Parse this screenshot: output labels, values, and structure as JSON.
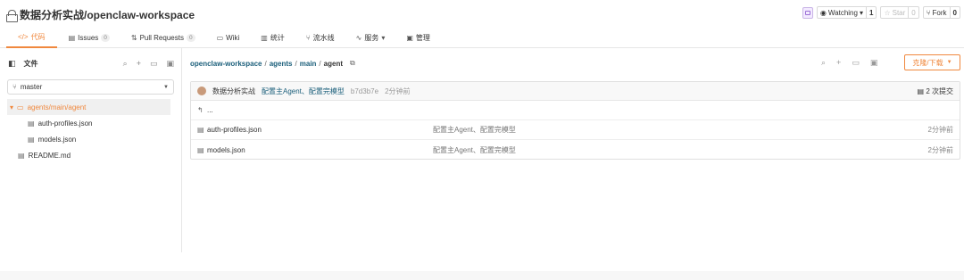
{
  "repo": {
    "title": "数据分析实战/openclaw-workspace"
  },
  "actions": {
    "watching_label": "Watching",
    "watching_count": "1",
    "star_label": "Star",
    "star_count": "0",
    "fork_label": "Fork",
    "fork_count": "0"
  },
  "tabs": [
    {
      "label": "代码",
      "icon": "code-icon"
    },
    {
      "label": "Issues",
      "badge": "0",
      "icon": "issues-icon"
    },
    {
      "label": "Pull Requests",
      "badge": "0",
      "icon": "pull-request-icon"
    },
    {
      "label": "Wiki",
      "icon": "wiki-icon"
    },
    {
      "label": "统计",
      "icon": "stats-icon"
    },
    {
      "label": "流水线",
      "icon": "pipeline-icon"
    },
    {
      "label": "服务",
      "icon": "service-icon"
    },
    {
      "label": "管理",
      "icon": "manage-icon"
    }
  ],
  "sidebar": {
    "title": "文件",
    "branch": "master",
    "tree": [
      {
        "label": "agents/main/agent"
      },
      {
        "label": "auth-profiles.json"
      },
      {
        "label": "models.json"
      },
      {
        "label": "README.md"
      }
    ]
  },
  "breadcrumb": {
    "repo": "openclaw-workspace",
    "p1": "agents",
    "p2": "main",
    "current": "agent"
  },
  "clone_label": "克隆/下载",
  "commit": {
    "author": "数据分析实战",
    "message": "配置主Agent、配置完模型",
    "sha": "b7d3b7e",
    "time": "2分钟前",
    "count": "2 次提交"
  },
  "files": [
    {
      "name": "auth-profiles.json",
      "message": "配置主Agent、配置完模型",
      "time": "2分钟前"
    },
    {
      "name": "models.json",
      "message": "配置主Agent、配置完模型",
      "time": "2分钟前"
    }
  ],
  "up_label": "..."
}
